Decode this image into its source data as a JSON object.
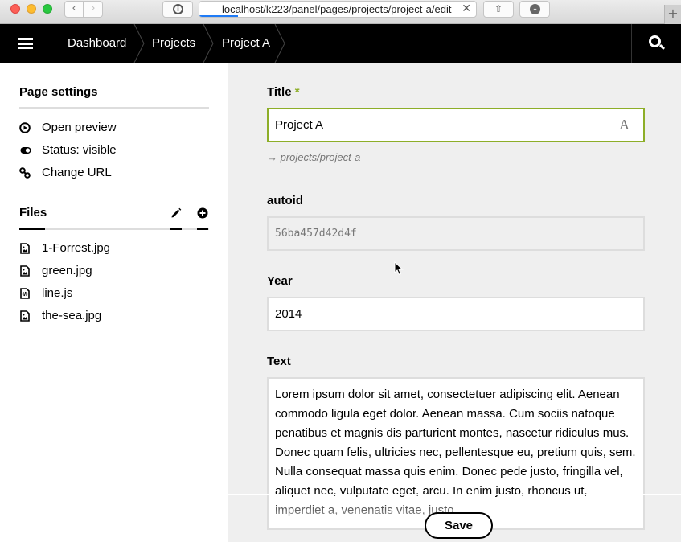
{
  "browser": {
    "url": "localhost/k223/panel/pages/projects/project-a/edit",
    "back_glyph": "‹",
    "forward_glyph": "›",
    "close_glyph": "✕",
    "newtab_glyph": "+",
    "reader_glyph": "i",
    "share_glyph": "⇧",
    "download_glyph": "↓",
    "load_progress": 0.14
  },
  "topbar": {
    "breadcrumbs": [
      "Dashboard",
      "Projects",
      "Project A"
    ]
  },
  "sidebar": {
    "page_settings": {
      "heading": "Page settings",
      "items": [
        {
          "label": "Open preview",
          "icon": "play-circle-icon"
        },
        {
          "label": "Status: visible",
          "icon": "toggle-on-icon"
        },
        {
          "label": "Change URL",
          "icon": "chain-link-icon"
        }
      ]
    },
    "files": {
      "heading": "Files",
      "edit_icon": "pencil-icon",
      "add_icon": "plus-circle-icon",
      "items": [
        {
          "label": "1-Forrest.jpg",
          "icon": "image-file-icon"
        },
        {
          "label": "green.jpg",
          "icon": "image-file-icon"
        },
        {
          "label": "line.js",
          "icon": "code-file-icon"
        },
        {
          "label": "the-sea.jpg",
          "icon": "image-file-icon"
        }
      ]
    }
  },
  "form": {
    "title": {
      "label": "Title",
      "required_mark": "*",
      "value": "Project A",
      "suffix": "A",
      "url_hint": "→ projects/project-a"
    },
    "autoid": {
      "label": "autoid",
      "value": "56ba457d42d4f"
    },
    "year": {
      "label": "Year",
      "value": "2014"
    },
    "text": {
      "label": "Text",
      "value": "Lorem ipsum dolor sit amet, consectetuer adipiscing elit. Aenean commodo ligula eget dolor. Aenean massa. Cum sociis natoque penatibus et magnis dis parturient montes, nascetur ridiculus mus. Donec quam felis, ultricies nec, pellentesque eu, pretium quis, sem. Nulla consequat massa quis enim. Donec pede justo, fringilla vel, aliquet nec, vulputate eget, arcu. In enim justo, rhoncus ut, imperdiet a, venenatis vitae, justo."
    },
    "save_label": "Save"
  },
  "colors": {
    "accent": "#8dae28",
    "topbar": "#000000",
    "sidebar": "#ffffff",
    "main": "#efefef"
  }
}
